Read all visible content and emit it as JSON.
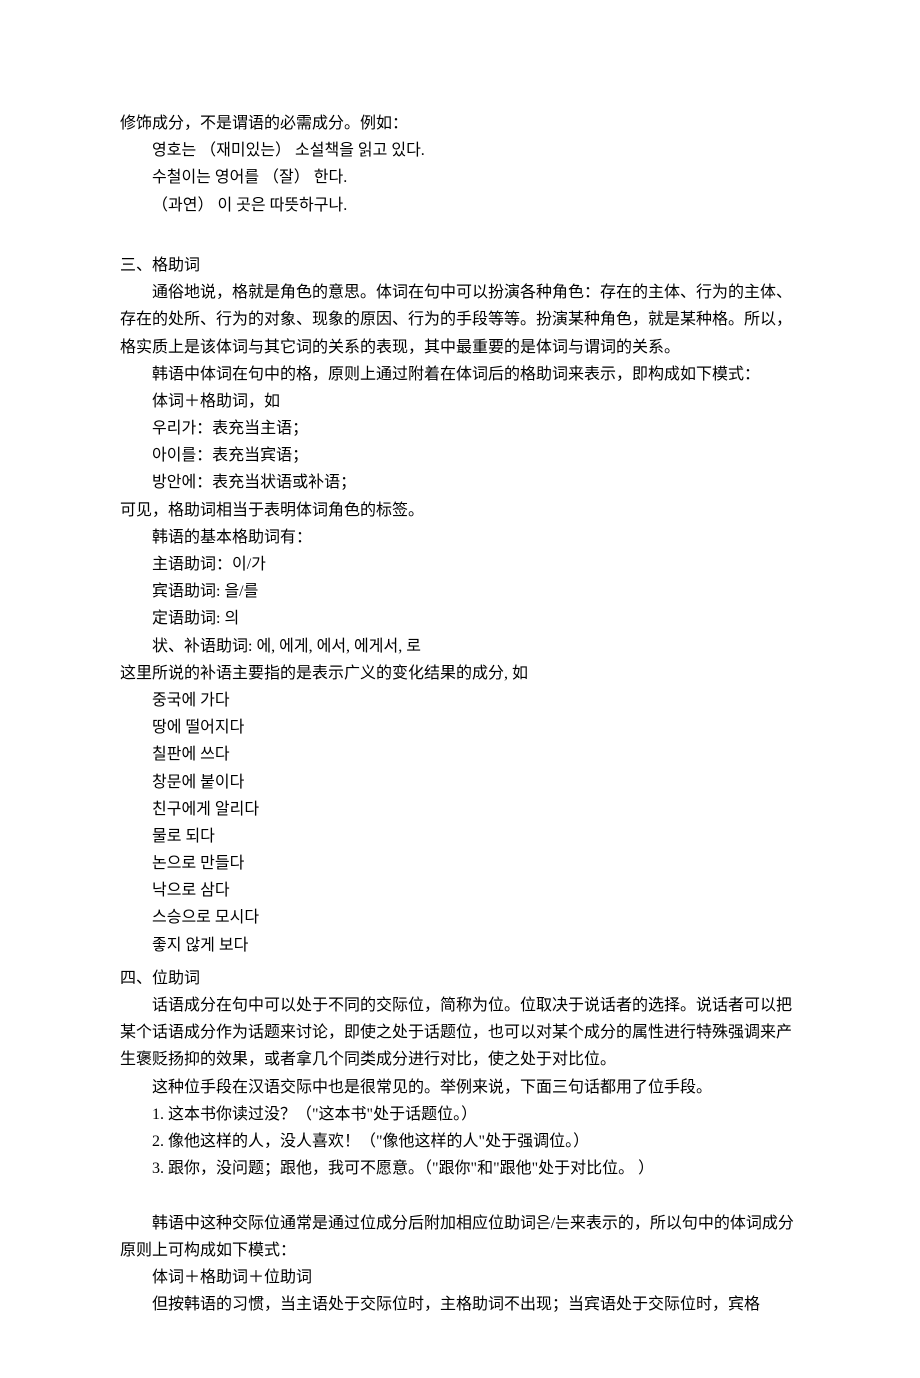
{
  "p1": "修饰成分，不是谓语的必需成分。例如：",
  "ex1_1": "영호는 （재미있는） 소설책을 읽고 있다.",
  "ex1_2": "수철이는 영어를 （잘） 한다.",
  "ex1_3": "（과연） 이 곳은 따뜻하구나.",
  "sec3_title": "三、格助词",
  "sec3_p1": "通俗地说，格就是角色的意思。体词在句中可以扮演各种角色：存在的主体、行为的主体、存在的处所、行为的对象、现象的原因、行为的手段等等。扮演某种角色，就是某种格。所以，格实质上是该体词与其它词的关系的表现，其中最重要的是体词与谓词的关系。",
  "sec3_p2": "韩语中体词在句中的格，原则上通过附着在体词后的格助词来表示，即构成如下模式：",
  "sec3_p3": "体词＋格助词，如",
  "sec3_ex1": "우리가：表充当主语；",
  "sec3_ex2": "아이를：表充当宾语；",
  "sec3_ex3": "방안에：表充当状语或补语；",
  "sec3_p4": "可见，格助词相当于表明体词角色的标签。",
  "sec3_p5": "韩语的基本格助词有：",
  "sec3_l1": "主语助词：이/가",
  "sec3_l2": "宾语助词: 을/를",
  "sec3_l3": "定语助词: 의",
  "sec3_l4": "状、补语助词: 에, 에게, 에서, 에게서, 로",
  "sec3_p6": "这里所说的补语主要指的是表示广义的变化结果的成分, 如",
  "sec3_ex_a": "중국에 가다",
  "sec3_ex_b": "땅에 떨어지다",
  "sec3_ex_c": "칠판에 쓰다",
  "sec3_ex_d": "창문에 붙이다",
  "sec3_ex_e": "친구에게 알리다",
  "sec3_ex_f": "물로 되다",
  "sec3_ex_g": "논으로 만들다",
  "sec3_ex_h": "낙으로 삼다",
  "sec3_ex_i": "스승으로 모시다",
  "sec3_ex_j": "좋지 않게 보다",
  "sec4_title": "四、位助词",
  "sec4_p1": "话语成分在句中可以处于不同的交际位，简称为位。位取决于说话者的选择。说话者可以把某个话语成分作为话题来讨论，即使之处于话题位，也可以对某个成分的属性进行特殊强调来产生褒贬扬抑的效果，或者拿几个同类成分进行对比，使之处于对比位。",
  "sec4_p2": "这种位手段在汉语交际中也是很常见的。举例来说，下面三句话都用了位手段。",
  "sec4_ex1": "1. 这本书你读过没？（\"这本书\"处于话题位。）",
  "sec4_ex2": "2. 像他这样的人，没人喜欢！（\"像他这样的人\"处于强调位。）",
  "sec4_ex3": "3. 跟你，没问题；跟他，我可不愿意。（\"跟你\"和\"跟他\"处于对比位。 ）",
  "sec4_p3": "韩语中这种交际位通常是通过位成分后附加相应位助词은/는来表示的，所以句中的体词成分原则上可构成如下模式：",
  "sec4_p4": "体词＋格助词＋位助词",
  "sec4_p5": "但按韩语的习惯，当主语处于交际位时，主格助词不出现；当宾语处于交际位时，宾格"
}
